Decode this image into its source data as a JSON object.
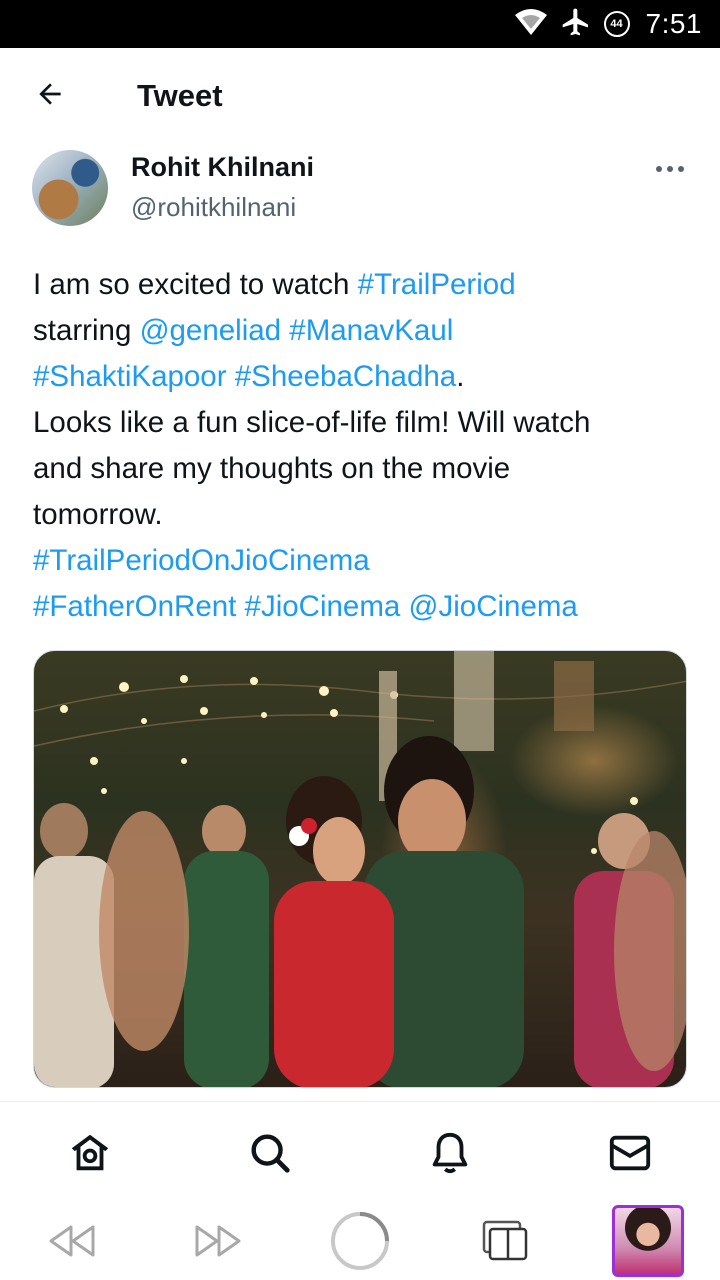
{
  "status_bar": {
    "time": "7:51",
    "battery_level": "44",
    "icons": [
      "wifi-icon",
      "airplane-mode-icon",
      "battery-saver-icon"
    ]
  },
  "header": {
    "title": "Tweet",
    "back_icon": "arrow-left-icon"
  },
  "author": {
    "name": "Rohit Khilnani",
    "handle": "@rohitkhilnani"
  },
  "tweet": {
    "lines": [
      [
        {
          "t": "I am so excited to watch ",
          "k": "text"
        },
        {
          "t": "#TrailPeriod",
          "k": "hashtag"
        }
      ],
      [
        {
          "t": "starring ",
          "k": "text"
        },
        {
          "t": "@geneliad",
          "k": "mention"
        },
        {
          "t": " ",
          "k": "text"
        },
        {
          "t": "#ManavKaul",
          "k": "hashtag"
        }
      ],
      [
        {
          "t": "#ShaktiKapoor",
          "k": "hashtag"
        },
        {
          "t": " ",
          "k": "text"
        },
        {
          "t": "#SheebaChadha",
          "k": "hashtag"
        },
        {
          "t": ".",
          "k": "text"
        }
      ],
      [
        {
          "t": "Looks like a fun slice-of-life film! Will watch",
          "k": "text"
        }
      ],
      [
        {
          "t": "and share my thoughts on the movie",
          "k": "text"
        }
      ],
      [
        {
          "t": "tomorrow.",
          "k": "text"
        }
      ],
      [
        {
          "t": "#TrailPeriodOnJioCinema",
          "k": "hashtag"
        }
      ],
      [
        {
          "t": "#FatherOnRent",
          "k": "hashtag"
        },
        {
          "t": " ",
          "k": "text"
        },
        {
          "t": "#JioCinema",
          "k": "hashtag"
        },
        {
          "t": " ",
          "k": "text"
        },
        {
          "t": "@JioCinema",
          "k": "mention"
        }
      ]
    ]
  },
  "colors": {
    "link": "#1d9bf0",
    "text": "#0f1419",
    "secondary": "#536471",
    "profile_border": "#9b30d9"
  },
  "bottom_nav": [
    "home-icon",
    "search-icon",
    "notifications-icon",
    "messages-icon"
  ],
  "browser_bar": [
    "back-icon",
    "forward-icon",
    "reload-icon",
    "tabs-icon",
    "profile-thumbnail"
  ]
}
